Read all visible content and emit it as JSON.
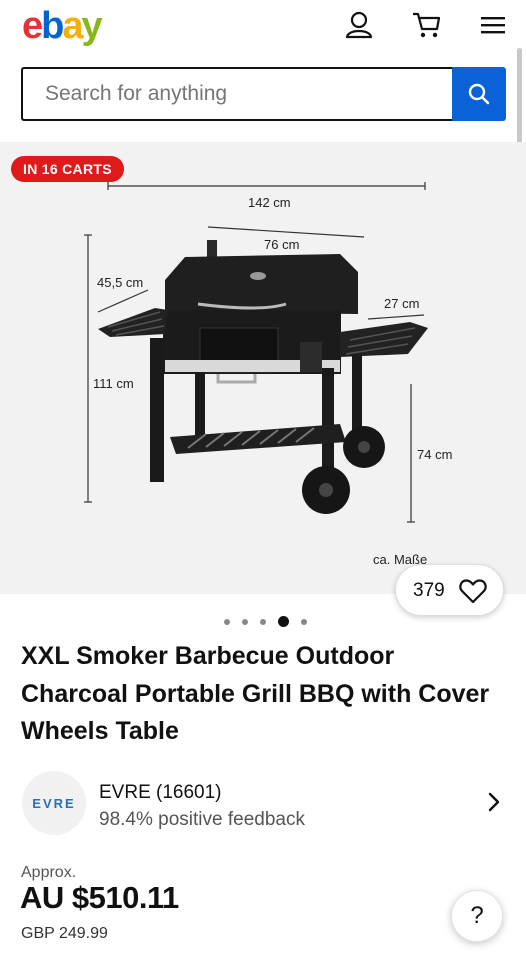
{
  "header": {
    "logo_letters": [
      "e",
      "b",
      "a",
      "y"
    ],
    "logo_colors": [
      "#e53238",
      "#0064d2",
      "#f5af02",
      "#86b817"
    ],
    "icons": [
      "account-icon",
      "cart-icon",
      "menu-icon"
    ]
  },
  "search": {
    "placeholder": "Search for anything",
    "value": ""
  },
  "gallery": {
    "badge": "IN 16 CARTS",
    "dimensions": {
      "total_width": "142 cm",
      "body_width": "76 cm",
      "depth": "45,5 cm",
      "table_depth": "27 cm",
      "total_height": "111 cm",
      "table_height": "74 cm",
      "note": "ca. Maße"
    },
    "like_count": "379",
    "dots_total": 5,
    "dots_active_index": 3
  },
  "listing": {
    "title": "XXL Smoker Barbecue Outdoor Charcoal Portable Grill BBQ with Cover Wheels Table"
  },
  "seller": {
    "logo_text": "EVRE",
    "name": "EVRE (16601)",
    "feedback": "98.4% positive feedback"
  },
  "price": {
    "approx_label": "Approx.",
    "main": "AU $510.11",
    "original": "GBP 249.99"
  },
  "help": {
    "label": "?"
  },
  "colors": {
    "accent": "#0b62d8",
    "badge": "#e0191b",
    "image_bg": "#f2f2f2"
  }
}
